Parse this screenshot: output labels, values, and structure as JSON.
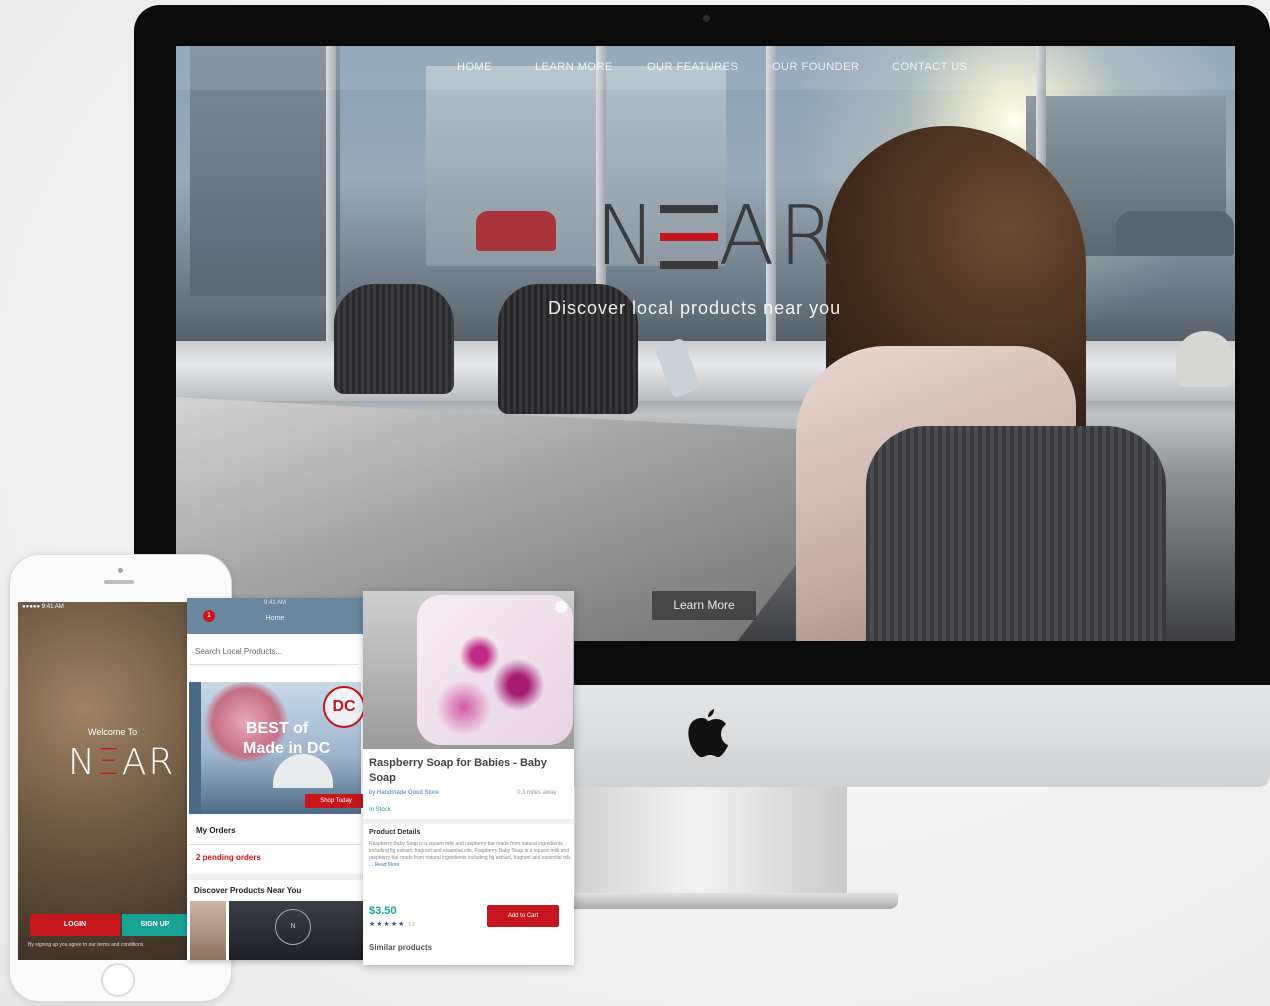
{
  "desktop": {
    "nav": {
      "items": [
        "HOME",
        "LEARN MORE",
        "OUR FEATURES",
        "OUR FOUNDER",
        "CONTACT US"
      ]
    },
    "hero": {
      "logo_n": "N",
      "logo_ar": "AR",
      "tagline": "Discover local products near you",
      "button": "Learn More"
    }
  },
  "phone": {
    "status": "●●●●● 9:41 AM",
    "welcome": "Welcome To",
    "logo_n": "N",
    "logo_e": "Ξ",
    "logo_ar": "AR",
    "login": "LOGIN",
    "signup": "SIGN UP",
    "terms": "By signing up you agree to our terms and conditions"
  },
  "home_screen": {
    "status": "9:41 AM",
    "title": "Home",
    "badge": "1",
    "search_placeholder": "Search Local Products...",
    "banner_line1": "BEST of",
    "banner_line2": "Made in DC",
    "banner_badge": "DC",
    "banner_button": "Shop Today",
    "orders_label": "My Orders",
    "pending": "2 pending orders",
    "discover": "Discover Products Near You",
    "thumb_badge": "N"
  },
  "product_screen": {
    "title": "Raspberry Soap for Babies - Baby Soap",
    "vendor": "by Handmade Good Store",
    "distance": "0.3 miles away",
    "stock": "In Stock",
    "details_heading": "Product Details",
    "description": "Raspberry Baby Soap is a square milk and raspberry bar made from natural ingredients including fig extract, fragrant and essential oils. Raspberry Baby Soap is a square milk and raspberry bar made from natural ingredients including fig extract, fragrant and essential oils ...",
    "read_more": "Read More",
    "price": "$3.50",
    "stars": "★★★★★",
    "rating_count": "12",
    "add_button": "Add to Cart",
    "similar": "Similar products"
  },
  "colors": {
    "brand_red": "#c4161c",
    "teal": "#18a394",
    "header_blue": "#6a87a0"
  }
}
